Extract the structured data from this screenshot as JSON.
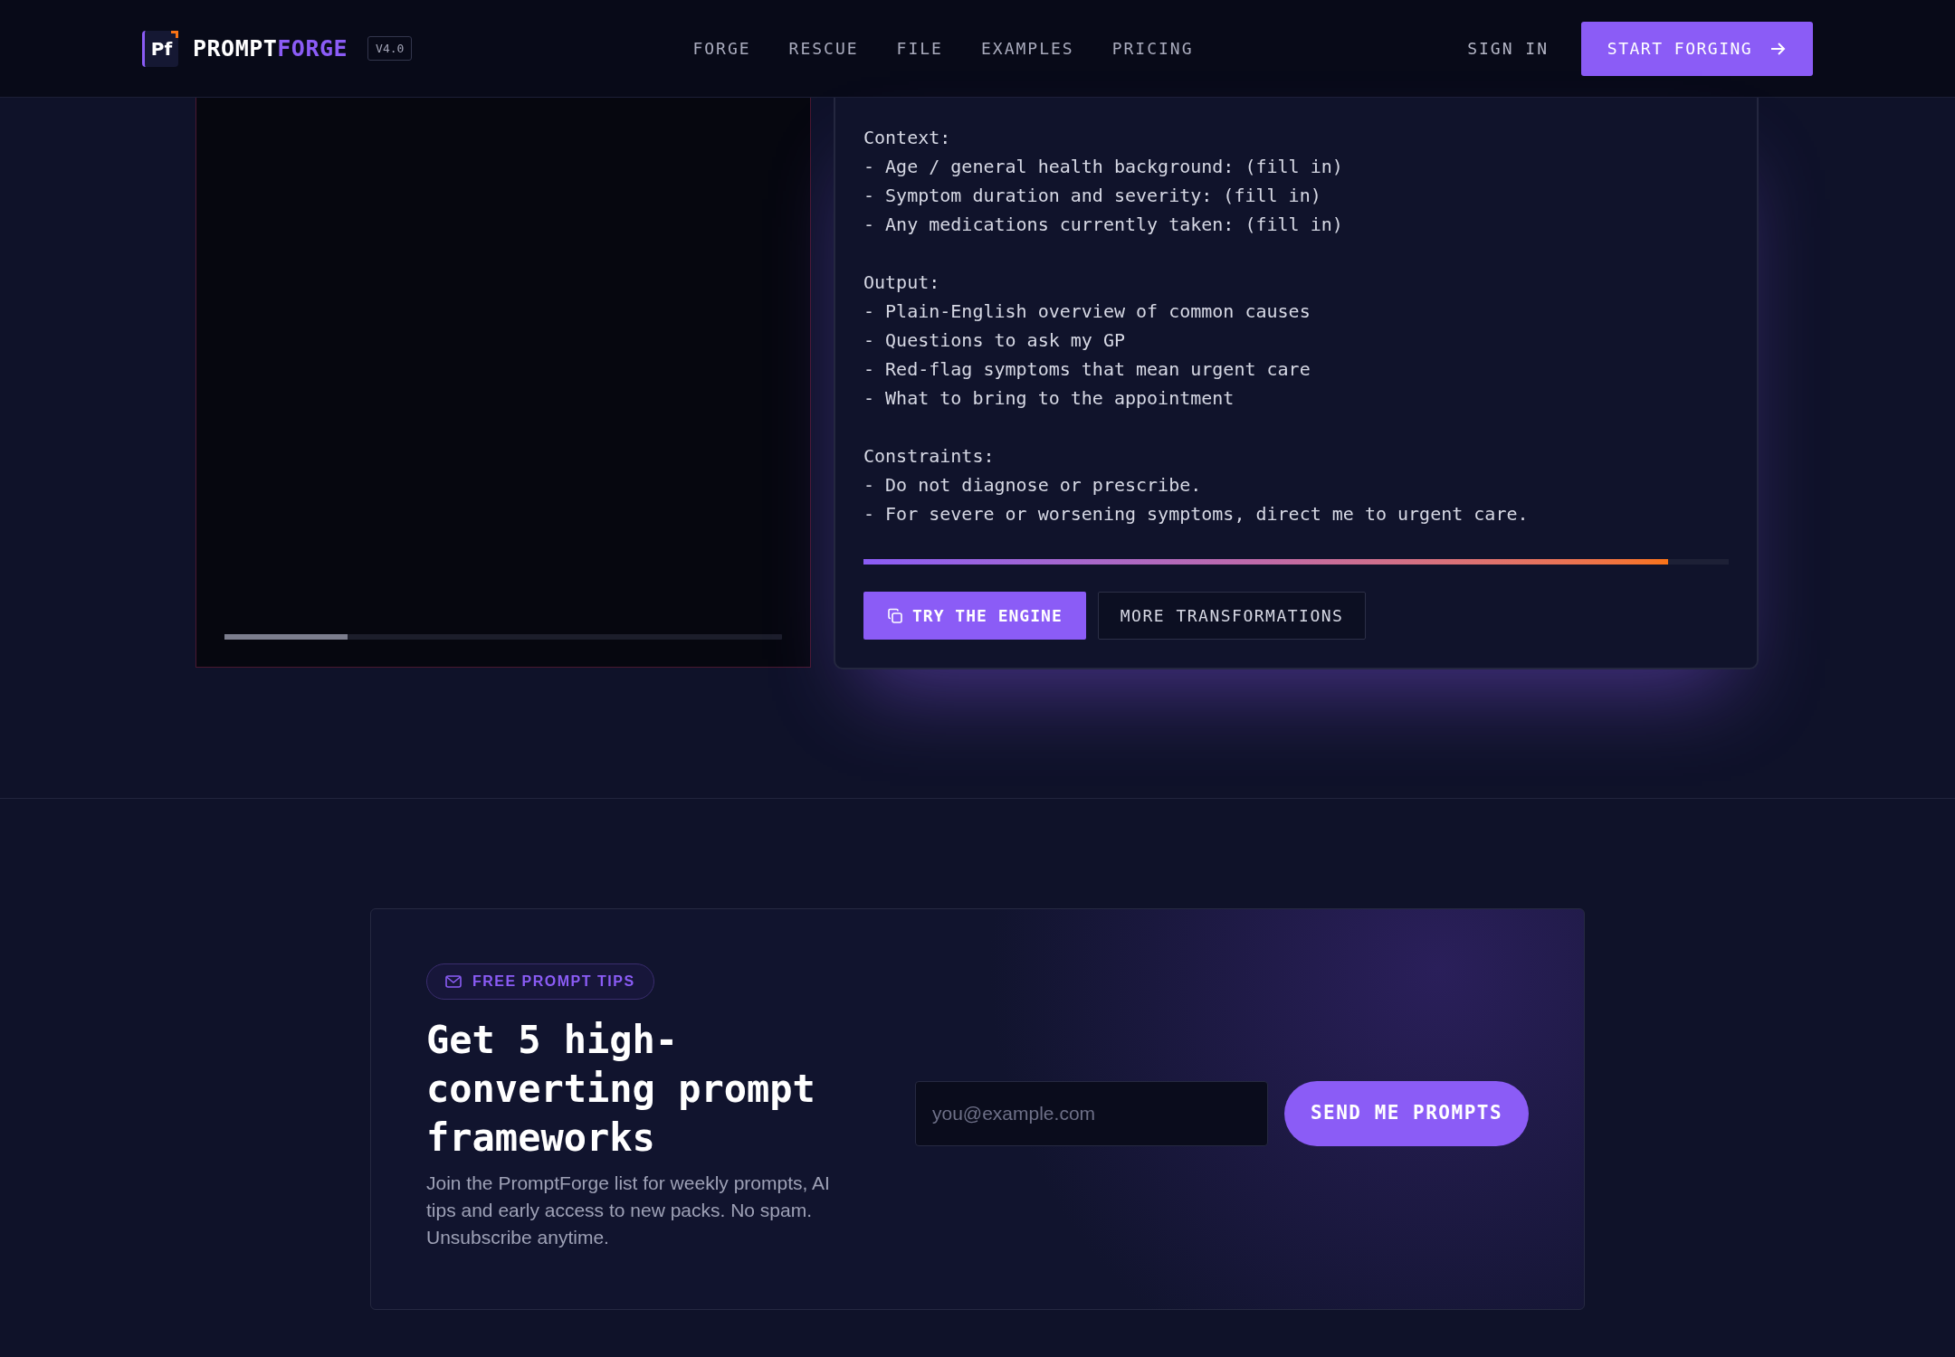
{
  "header": {
    "logo": {
      "mark": "Pf",
      "name_first": "PROMPT",
      "name_second": "FORGE"
    },
    "version": "V4.0",
    "nav": [
      "FORGE",
      "RESCUE",
      "FILE",
      "EXAMPLES",
      "PRICING"
    ],
    "sign_in": "SIGN IN",
    "cta": "START FORGING"
  },
  "demo": {
    "input_panel": {
      "scroll_bar": {
        "level": 0.22
      }
    },
    "output_panel": {
      "sections": [
        {
          "heading": "Context:",
          "lines": [
            "- Age / general health background: (fill in)",
            "- Symptom duration and severity: (fill in)",
            "- Any medications currently taken: (fill in)"
          ]
        },
        {
          "heading": "Output:",
          "lines": [
            "- Plain-English overview of common causes",
            "- Questions to ask my GP",
            "- Red-flag symptoms that mean urgent care",
            "- What to bring to the appointment"
          ]
        },
        {
          "heading": "Constraints:",
          "lines": [
            "- Do not diagnose or prescribe.",
            "- For severe or worsening symptoms, direct me to urgent care."
          ]
        }
      ],
      "progress": {
        "level": 0.93
      },
      "buttons": [
        {
          "label": "TRY THE ENGINE",
          "kind": "primary"
        },
        {
          "label": "MORE TRANSFORMATIONS",
          "kind": "secondary"
        }
      ]
    }
  },
  "newsletter": {
    "badge": "FREE PROMPT TIPS",
    "title": "Get 5 high-converting prompt frameworks",
    "text": "Join the PromptForge list for weekly prompts, AI tips and early access to new packs. No spam. Unsubscribe anytime.",
    "email": {
      "placeholder": "you@example.com"
    },
    "button": "SEND ME PROMPTS"
  }
}
